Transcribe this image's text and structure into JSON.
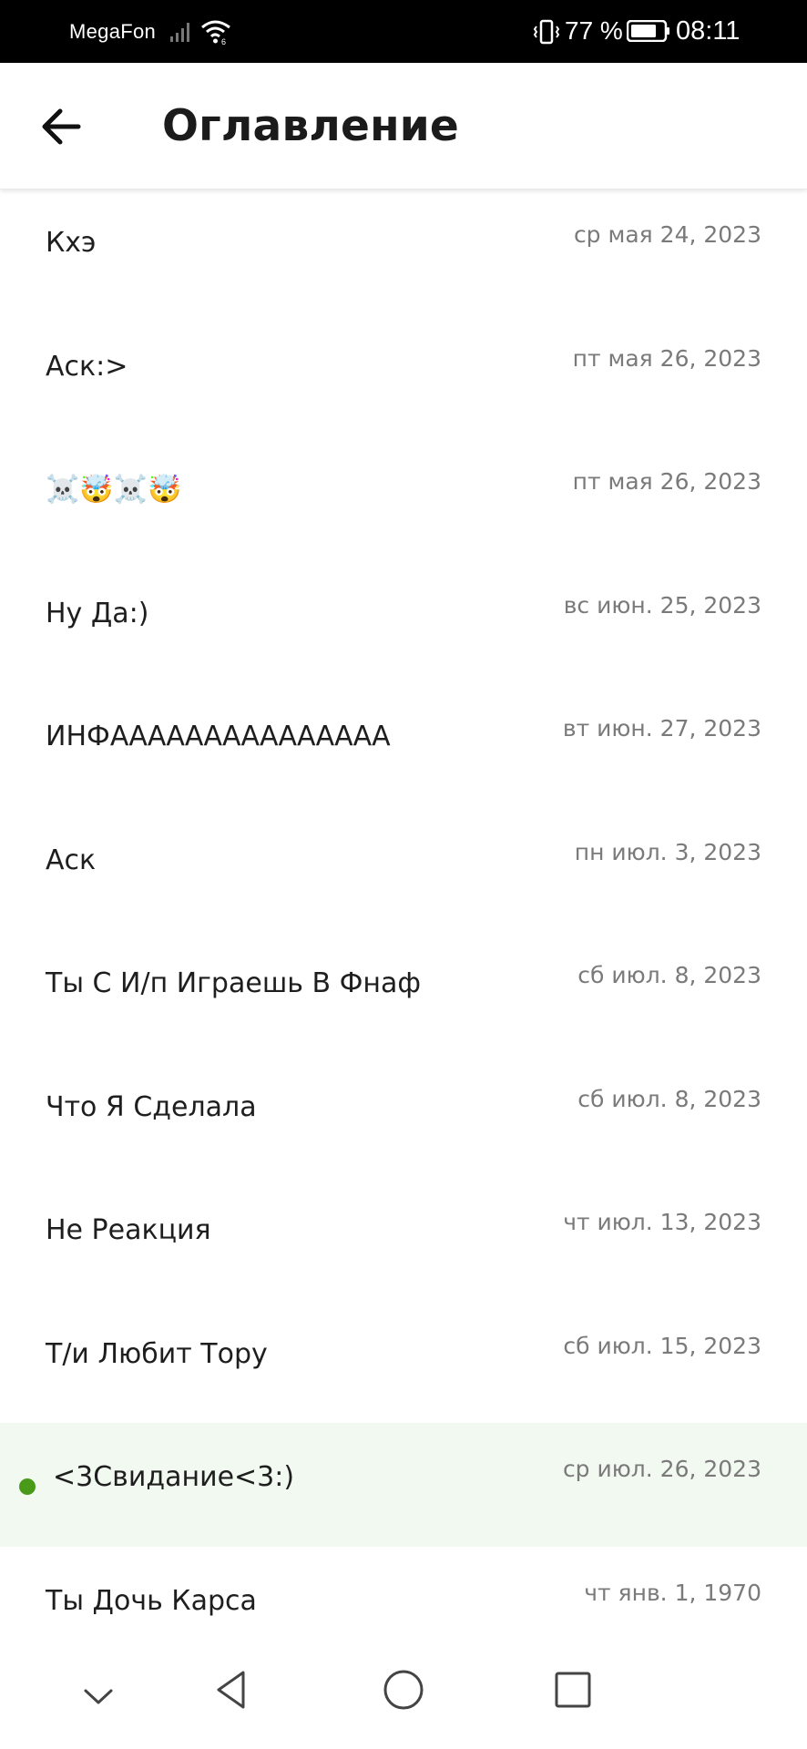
{
  "status_bar": {
    "carrier": "MegaFon",
    "battery_percent": "77 %",
    "time": "08:11",
    "icons": [
      "signal-icon",
      "wifi-icon",
      "vibrate-icon",
      "battery-icon"
    ]
  },
  "header": {
    "title": "Оглавление",
    "back_icon": "arrow-left-icon"
  },
  "chapters": [
    {
      "title": "Кхэ",
      "date": "ср мая 24, 2023"
    },
    {
      "title": "Аск:>",
      "date": "пт мая 26, 2023"
    },
    {
      "title": "☠️🤯☠️🤯",
      "date": "пт мая 26, 2023"
    },
    {
      "title": "Ну Да:)",
      "date": "вс июн. 25, 2023"
    },
    {
      "title": "ИНФААААААААААААААА",
      "date": "вт июн. 27, 2023"
    },
    {
      "title": "Аск",
      "date": "пн июл. 3, 2023"
    },
    {
      "title": "Ты С И/п Играешь В Фнаф",
      "date": "сб июл. 8, 2023"
    },
    {
      "title": "Что Я Сделала",
      "date": "сб июл. 8, 2023"
    },
    {
      "title": "Не Реакция",
      "date": "чт июл. 13, 2023"
    },
    {
      "title": "Т/и Любит Тору",
      "date": "сб июл. 15, 2023"
    },
    {
      "title": "<3Свидание<3:)",
      "date": "ср июл. 26, 2023",
      "current": true
    },
    {
      "title": "Ты Дочь Карса",
      "date": "чт янв. 1, 1970"
    }
  ],
  "colors": {
    "current_highlight": "#f2f9f0",
    "current_dot": "#4a9a1a"
  },
  "nav_bar": {
    "icons": [
      "chevron-down-icon",
      "back-triangle-icon",
      "home-circle-icon",
      "recents-square-icon"
    ]
  }
}
